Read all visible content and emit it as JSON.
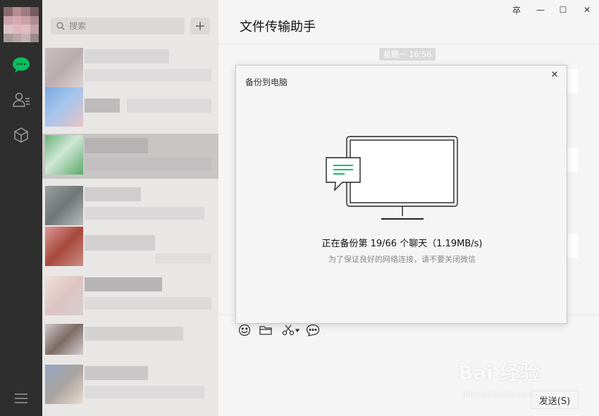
{
  "search": {
    "placeholder": "搜索"
  },
  "main": {
    "title": "文件传输助手",
    "time_label": "星期一 16:56",
    "window_controls": {
      "pin": "卒",
      "minimize": "—",
      "maximize": "☐",
      "close": "✕"
    },
    "send_label": "发送(S)"
  },
  "dialog": {
    "title": "备份到电脑",
    "close": "✕",
    "status": "正在备份第 19/66 个聊天（1.19MB/s)",
    "hint": "为了保证良好的网络连接，请不要关闭微信"
  },
  "watermark": {
    "brand": "Bai 经验",
    "url": "jingyan.baidu.com"
  },
  "icons": {
    "nav": [
      "chat-icon",
      "contacts-icon",
      "cube-icon",
      "menu-icon"
    ],
    "toolbar": [
      "emoji-icon",
      "folder-icon",
      "scissors-icon",
      "chat-bubble-icon"
    ]
  },
  "colors": {
    "accent": "#07c160",
    "nav_bg": "#2e2e2e",
    "list_bg": "#e9e7e6",
    "main_bg": "#f5f5f5"
  }
}
